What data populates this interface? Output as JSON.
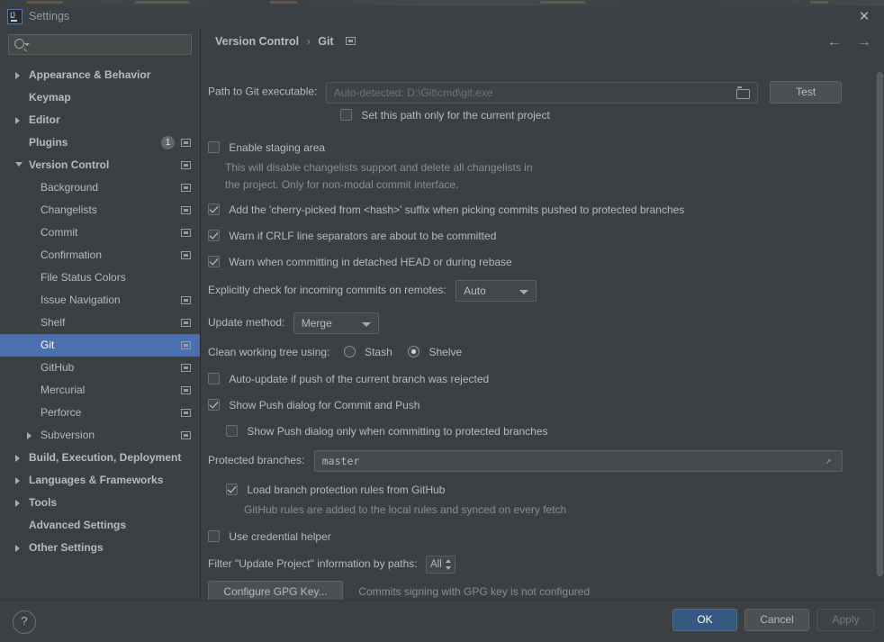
{
  "window": {
    "title": "Settings",
    "app_icon": "intellij-idea-icon",
    "close_label": "✕"
  },
  "colors": {
    "selection_blue": "#4b6eaf",
    "primary_button": "#365880",
    "panel_bg": "#3c3f41",
    "field_bg": "#45494a"
  },
  "sidebar": {
    "search": {
      "value": "",
      "placeholder": ""
    },
    "items": [
      {
        "label": "Appearance & Behavior",
        "arrow": "collapsed",
        "level": "top",
        "panel_icon": false,
        "badge": null,
        "selected": false
      },
      {
        "label": "Keymap",
        "arrow": "none",
        "level": "top",
        "panel_icon": false,
        "badge": null,
        "selected": false
      },
      {
        "label": "Editor",
        "arrow": "collapsed",
        "level": "top",
        "panel_icon": false,
        "badge": null,
        "selected": false
      },
      {
        "label": "Plugins",
        "arrow": "none",
        "level": "top",
        "panel_icon": true,
        "badge": "1",
        "selected": false
      },
      {
        "label": "Version Control",
        "arrow": "expanded",
        "level": "top",
        "panel_icon": true,
        "badge": null,
        "selected": false
      },
      {
        "label": "Background",
        "arrow": "none",
        "level": "child",
        "panel_icon": true,
        "badge": null,
        "selected": false
      },
      {
        "label": "Changelists",
        "arrow": "none",
        "level": "child",
        "panel_icon": true,
        "badge": null,
        "selected": false
      },
      {
        "label": "Commit",
        "arrow": "none",
        "level": "child",
        "panel_icon": true,
        "badge": null,
        "selected": false
      },
      {
        "label": "Confirmation",
        "arrow": "none",
        "level": "child",
        "panel_icon": true,
        "badge": null,
        "selected": false
      },
      {
        "label": "File Status Colors",
        "arrow": "none",
        "level": "child",
        "panel_icon": false,
        "badge": null,
        "selected": false
      },
      {
        "label": "Issue Navigation",
        "arrow": "none",
        "level": "child",
        "panel_icon": true,
        "badge": null,
        "selected": false
      },
      {
        "label": "Shelf",
        "arrow": "none",
        "level": "child",
        "panel_icon": true,
        "badge": null,
        "selected": false
      },
      {
        "label": "Git",
        "arrow": "none",
        "level": "child",
        "panel_icon": true,
        "badge": null,
        "selected": true
      },
      {
        "label": "GitHub",
        "arrow": "none",
        "level": "child",
        "panel_icon": true,
        "badge": null,
        "selected": false
      },
      {
        "label": "Mercurial",
        "arrow": "none",
        "level": "child",
        "panel_icon": true,
        "badge": null,
        "selected": false
      },
      {
        "label": "Perforce",
        "arrow": "none",
        "level": "child",
        "panel_icon": true,
        "badge": null,
        "selected": false
      },
      {
        "label": "Subversion",
        "arrow": "collapsed",
        "level": "child2",
        "panel_icon": true,
        "badge": null,
        "selected": false
      },
      {
        "label": "Build, Execution, Deployment",
        "arrow": "collapsed",
        "level": "top",
        "panel_icon": false,
        "badge": null,
        "selected": false
      },
      {
        "label": "Languages & Frameworks",
        "arrow": "collapsed",
        "level": "top",
        "panel_icon": false,
        "badge": null,
        "selected": false
      },
      {
        "label": "Tools",
        "arrow": "collapsed",
        "level": "top",
        "panel_icon": false,
        "badge": null,
        "selected": false
      },
      {
        "label": "Advanced Settings",
        "arrow": "none",
        "level": "top",
        "panel_icon": false,
        "badge": null,
        "selected": false
      },
      {
        "label": "Other Settings",
        "arrow": "collapsed",
        "level": "top",
        "panel_icon": false,
        "badge": null,
        "selected": false
      }
    ]
  },
  "breadcrumb": {
    "root": "Version Control",
    "separator": "›",
    "current": "Git",
    "reset_icon": "panel-reset-icon",
    "back_icon": "←",
    "forward_icon": "→"
  },
  "form": {
    "git_path": {
      "label": "Path to Git executable:",
      "value": "Auto-detected: D:\\Git\\cmd\\git.exe",
      "browse_icon": "folder-icon",
      "test_button": "Test"
    },
    "set_path_current_project": {
      "label": "Set this path only for the current project",
      "checked": false
    },
    "enable_staging": {
      "label": "Enable staging area",
      "checked": false,
      "hint_line1": "This will disable changelists support and delete all changelists in",
      "hint_line2": "the project. Only for non-modal commit interface."
    },
    "cherry_picked": {
      "label": "Add the 'cherry-picked from <hash>' suffix when picking commits pushed to protected branches",
      "checked": true
    },
    "warn_crlf": {
      "label": "Warn if CRLF line separators are about to be committed",
      "checked": true
    },
    "warn_detached": {
      "label": "Warn when committing in detached HEAD or during rebase",
      "checked": true
    },
    "incoming_commits": {
      "label": "Explicitly check for incoming commits on remotes:",
      "value": "Auto"
    },
    "update_method": {
      "label": "Update method:",
      "value": "Merge"
    },
    "clean_working_tree": {
      "label": "Clean working tree using:",
      "option_stash": "Stash",
      "option_shelve": "Shelve",
      "selected": "Shelve"
    },
    "auto_update_push": {
      "label": "Auto-update if push of the current branch was rejected",
      "checked": false
    },
    "show_push_dialog": {
      "label": "Show Push dialog for Commit and Push",
      "checked": true
    },
    "show_push_protected": {
      "label": "Show Push dialog only when committing to protected branches",
      "checked": false
    },
    "protected_branches": {
      "label": "Protected branches:",
      "value": "master",
      "expand_icon": "expand-field-icon"
    },
    "load_branch_rules": {
      "label": "Load branch protection rules from GitHub",
      "checked": true,
      "hint": "GitHub rules are added to the local rules and synced on every fetch"
    },
    "use_credential_helper": {
      "label": "Use credential helper",
      "checked": false
    },
    "filter_update_project": {
      "label": "Filter \"Update Project\" information by paths:",
      "value": "All"
    },
    "gpg": {
      "button": "Configure GPG Key...",
      "status": "Commits signing with GPG key is not configured"
    }
  },
  "footer": {
    "help_label": "?",
    "ok": "OK",
    "cancel": "Cancel",
    "apply": "Apply"
  }
}
